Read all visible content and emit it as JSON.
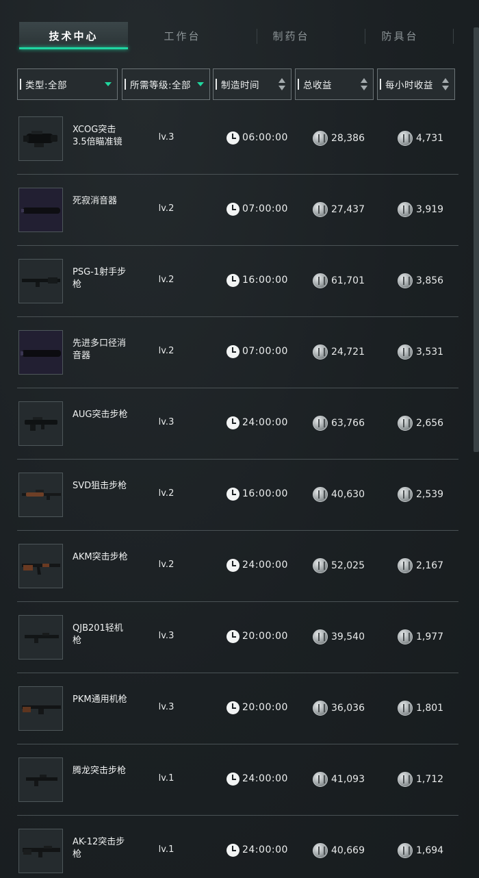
{
  "tabs": [
    {
      "label": "技术中心",
      "active": true
    },
    {
      "label": "工作台",
      "active": false
    },
    {
      "label": "制药台",
      "active": false
    },
    {
      "label": "防具台",
      "active": false
    }
  ],
  "filters": {
    "type": "类型:全部",
    "level": "所需等级:全部",
    "time": "制造时间",
    "total": "总收益",
    "hourly": "每小时收益"
  },
  "items": [
    {
      "name": "XCOG突击3.5倍瞄准镜",
      "level": "lv.3",
      "time": "06:00:00",
      "total": "28,386",
      "hourly": "4,731",
      "icon": "scope-icon"
    },
    {
      "name": "死寂消音器",
      "level": "lv.2",
      "time": "07:00:00",
      "total": "27,437",
      "hourly": "3,919",
      "icon": "silencer-icon"
    },
    {
      "name": "PSG-1射手步枪",
      "level": "lv.2",
      "time": "16:00:00",
      "total": "61,701",
      "hourly": "3,856",
      "icon": "rifle-icon"
    },
    {
      "name": "先进多口径消音器",
      "level": "lv.2",
      "time": "07:00:00",
      "total": "24,721",
      "hourly": "3,531",
      "icon": "silencer-icon"
    },
    {
      "name": "AUG突击步枪",
      "level": "lv.3",
      "time": "24:00:00",
      "total": "63,766",
      "hourly": "2,656",
      "icon": "rifle-icon"
    },
    {
      "name": "SVD狙击步枪",
      "level": "lv.2",
      "time": "16:00:00",
      "total": "40,630",
      "hourly": "2,539",
      "icon": "sniper-icon"
    },
    {
      "name": "AKM突击步枪",
      "level": "lv.2",
      "time": "24:00:00",
      "total": "52,025",
      "hourly": "2,167",
      "icon": "rifle-icon"
    },
    {
      "name": "QJB201轻机枪",
      "level": "lv.3",
      "time": "20:00:00",
      "total": "39,540",
      "hourly": "1,977",
      "icon": "rifle-icon"
    },
    {
      "name": "PKM通用机枪",
      "level": "lv.3",
      "time": "20:00:00",
      "total": "36,036",
      "hourly": "1,801",
      "icon": "rifle-icon"
    },
    {
      "name": "腾龙突击步枪",
      "level": "lv.1",
      "time": "24:00:00",
      "total": "41,093",
      "hourly": "1,712",
      "icon": "rifle-icon"
    },
    {
      "name": "AK-12突击步枪",
      "level": "lv.1",
      "time": "24:00:00",
      "total": "40,669",
      "hourly": "1,694",
      "icon": "rifle-icon"
    }
  ]
}
